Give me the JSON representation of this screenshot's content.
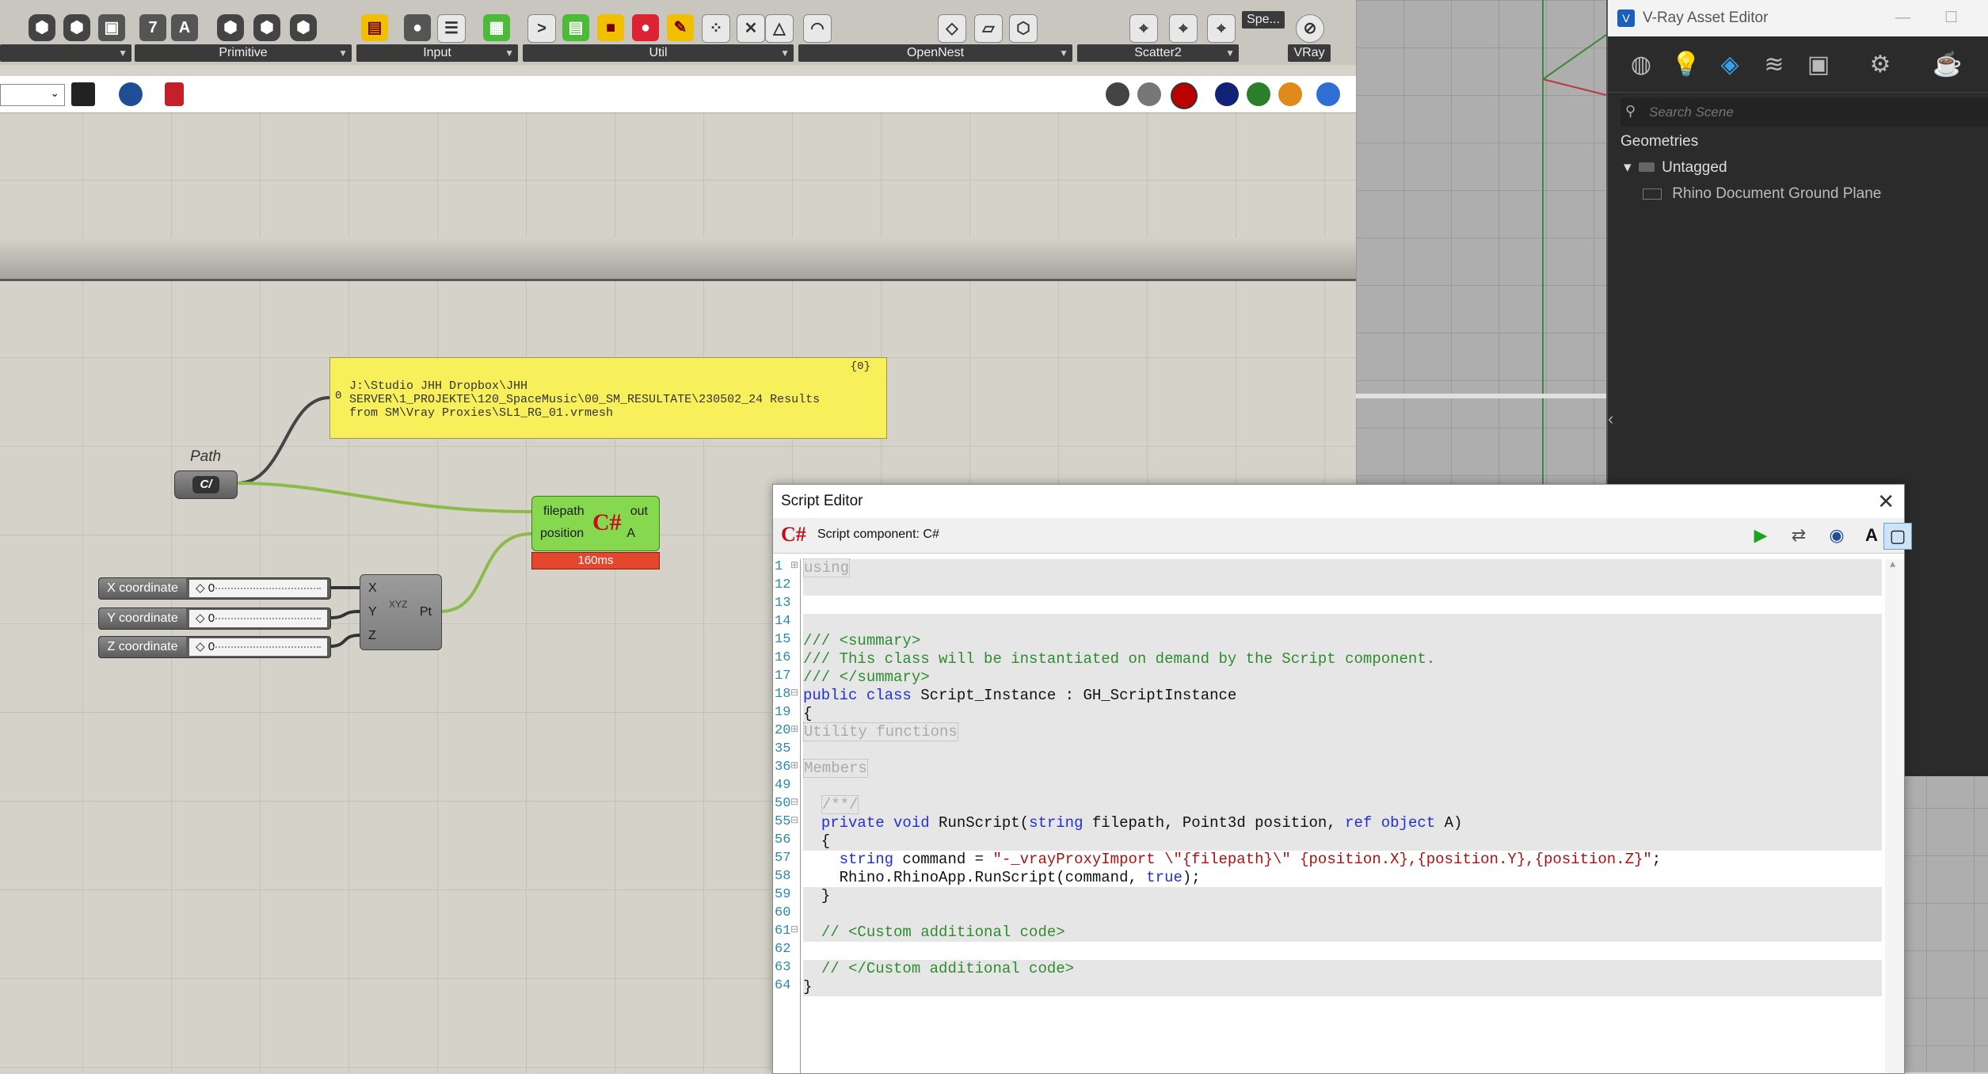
{
  "ribbon": {
    "groups": [
      {
        "label": ""
      },
      {
        "label": "Primitive"
      },
      {
        "label": "Input"
      },
      {
        "label": "Util"
      },
      {
        "label": "OpenNest"
      },
      {
        "label": "Scatter2"
      },
      {
        "label": "Spe..."
      },
      {
        "label": "VRay"
      }
    ]
  },
  "canvas": {
    "panel": {
      "index": "{0}",
      "row": "0",
      "text": "J:\\Studio JHH Dropbox\\JHH\nSERVER\\1_PROJEKTE\\120_SpaceMusic\\00_SM_RESULTATE\\230502_24 Results\nfrom SM\\Vray Proxies\\SL1_RG_01.vrmesh"
    },
    "path_label": "Path",
    "path_icon": "C/",
    "csharp": {
      "in1": "filepath",
      "in2": "position",
      "out1": "out",
      "out2": "A",
      "icon": "C#",
      "timer": "160ms"
    },
    "sliders": [
      {
        "label": "X coordinate",
        "value": "◇ 0"
      },
      {
        "label": "Y coordinate",
        "value": "◇ 0"
      },
      {
        "label": "Z coordinate",
        "value": "◇ 0"
      }
    ],
    "pt": {
      "x": "X",
      "y": "Y",
      "z": "Z",
      "out": "Pt",
      "glyph": "XYZ"
    }
  },
  "vray": {
    "title": "V-Ray Asset Editor",
    "search_placeholder": "Search Scene",
    "tree": {
      "root": "Geometries",
      "group": "Untagged",
      "item": "Rhino Document Ground Plane"
    }
  },
  "editor": {
    "title": "Script Editor",
    "subtitle": "Script component: C#",
    "lines": [
      {
        "n": "1",
        "shade": true,
        "fold": "⊞",
        "html": "<span class='dim'>using</span>"
      },
      {
        "n": "12",
        "shade": true,
        "fold": "",
        "html": ""
      },
      {
        "n": "13",
        "shade": false,
        "fold": "",
        "html": ""
      },
      {
        "n": "14",
        "shade": true,
        "fold": "",
        "html": ""
      },
      {
        "n": "15",
        "shade": true,
        "fold": "",
        "html": "<span class='cm'>/// &lt;summary&gt;</span>"
      },
      {
        "n": "16",
        "shade": true,
        "fold": "",
        "html": "<span class='cm'>/// This class will be instantiated on demand by the Script component.</span>"
      },
      {
        "n": "17",
        "shade": true,
        "fold": "",
        "html": "<span class='cm'>/// &lt;/summary&gt;</span>"
      },
      {
        "n": "18",
        "shade": true,
        "fold": "⊟",
        "html": "<span class='kw'>public class</span> Script_Instance : GH_ScriptInstance"
      },
      {
        "n": "19",
        "shade": true,
        "fold": "",
        "html": "{"
      },
      {
        "n": "20",
        "shade": true,
        "fold": "⊞",
        "html": "<span class='dim'>Utility functions</span>"
      },
      {
        "n": "35",
        "shade": true,
        "fold": "",
        "html": ""
      },
      {
        "n": "36",
        "shade": true,
        "fold": "⊞",
        "html": "<span class='dim'>Members</span>"
      },
      {
        "n": "49",
        "shade": true,
        "fold": "",
        "html": ""
      },
      {
        "n": "50",
        "shade": true,
        "fold": "⊟",
        "html": "  <span class='dim'>/**/</span>"
      },
      {
        "n": "55",
        "shade": true,
        "fold": "⊟",
        "html": "  <span class='kw'>private void</span> RunScript(<span class='kw'>string</span> filepath, Point3d position, <span class='kw'>ref object</span> A)"
      },
      {
        "n": "56",
        "shade": true,
        "fold": "",
        "html": "  {"
      },
      {
        "n": "57",
        "shade": false,
        "fold": "",
        "html": "    <span class='kw'>string</span> command = <span class='str'>\"-_vrayProxyImport \\\"{filepath}\\\" {position.X},{position.Y},{position.Z}\"</span>;"
      },
      {
        "n": "58",
        "shade": false,
        "fold": "",
        "html": "    Rhino.RhinoApp.RunScript(command, <span class='kw'>true</span>);"
      },
      {
        "n": "59",
        "shade": true,
        "fold": "",
        "html": "  }"
      },
      {
        "n": "60",
        "shade": true,
        "fold": "",
        "html": ""
      },
      {
        "n": "61",
        "shade": true,
        "fold": "⊟",
        "html": "  <span class='cm'>// &lt;Custom additional code&gt;</span>"
      },
      {
        "n": "62",
        "shade": false,
        "fold": "",
        "html": ""
      },
      {
        "n": "63",
        "shade": true,
        "fold": "",
        "html": "  <span class='cm'>// &lt;/Custom additional code&gt;</span>"
      },
      {
        "n": "64",
        "shade": true,
        "fold": "",
        "html": "}"
      }
    ]
  }
}
